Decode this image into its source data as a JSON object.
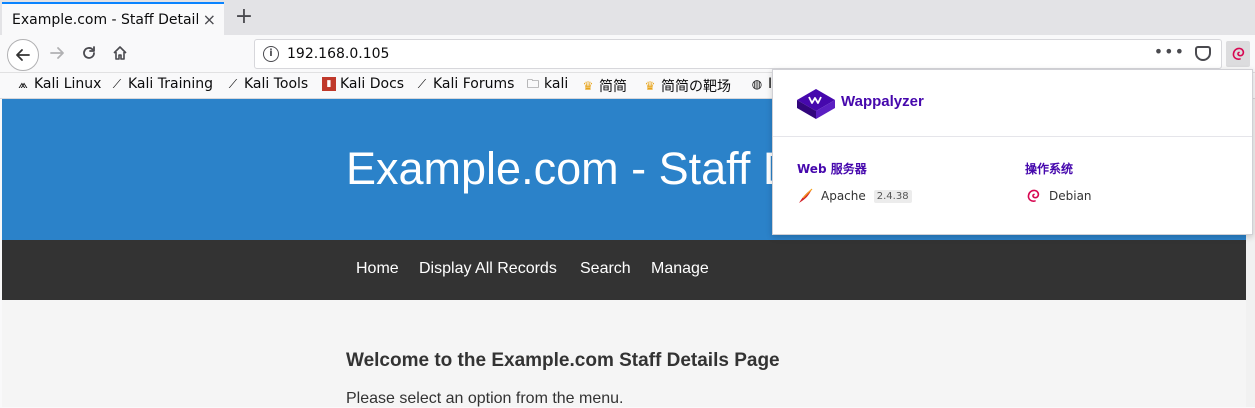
{
  "browser": {
    "tab_title": "Example.com - Staff Details",
    "tab_close": "×",
    "new_tab": "+",
    "url": "192.168.0.105",
    "page_actions": "•••"
  },
  "bookmarks": [
    {
      "label": "Kali Linux",
      "icon": "kali-dragon-icon"
    },
    {
      "label": "Kali Training",
      "icon": "kali-dragon-icon"
    },
    {
      "label": "Kali Tools",
      "icon": "kali-dragon-icon"
    },
    {
      "label": "Kali Docs",
      "icon": "kali-docs-icon"
    },
    {
      "label": "Kali Forums",
      "icon": "kali-dragon-icon"
    },
    {
      "label": "kali",
      "icon": "folder-icon"
    },
    {
      "label": "简简",
      "icon": "crown-icon"
    },
    {
      "label": "简简の靶场",
      "icon": "crown-icon"
    },
    {
      "label": "I",
      "icon": "globe-icon"
    }
  ],
  "page": {
    "header_title": "Example.com - Staff Details",
    "menu": [
      "Home",
      "Display All Records",
      "Search",
      "Manage"
    ],
    "welcome": "Welcome to the Example.com Staff Details Page",
    "intro": "Please select an option from the menu."
  },
  "wappalyzer": {
    "brand": "Wappalyzer",
    "brand_color": "#4608ad",
    "categories": [
      {
        "name": "Web 服务器",
        "tech": "Apache",
        "version": "2.4.38",
        "icon": "apache-feather-icon"
      },
      {
        "name": "操作系统",
        "tech": "Debian",
        "version": "",
        "icon": "debian-swirl-icon"
      }
    ]
  }
}
